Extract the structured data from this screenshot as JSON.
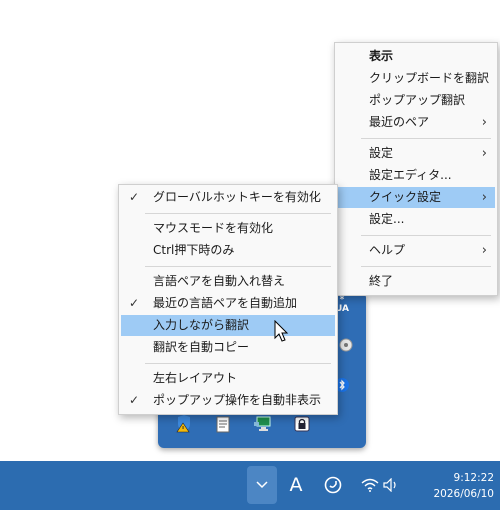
{
  "main_menu": {
    "items": [
      {
        "label": "表示",
        "bold": true,
        "submenu": false
      },
      {
        "label": "クリップボードを翻訳",
        "submenu": false
      },
      {
        "label": "ポップアップ翻訳",
        "submenu": false
      },
      {
        "label": "最近のペア",
        "submenu": true
      },
      {
        "label": "設定",
        "submenu": true
      },
      {
        "label": "設定エディタ...",
        "submenu": false
      },
      {
        "label": "クイック設定",
        "submenu": true,
        "highlighted": true
      },
      {
        "label": "設定...",
        "submenu": false
      },
      {
        "label": "ヘルプ",
        "submenu": true
      },
      {
        "label": "終了",
        "submenu": false
      }
    ]
  },
  "quick_settings_menu": {
    "items": [
      {
        "label": "グローバルホットキーを有効化",
        "checked": true
      },
      {
        "label": "マウスモードを有効化",
        "checked": false
      },
      {
        "label": "Ctrl押下時のみ",
        "checked": false
      },
      {
        "label": "言語ペアを自動入れ替え",
        "checked": false
      },
      {
        "label": "最近の言語ペアを自動追加",
        "checked": true
      },
      {
        "label": "入力しながら翻訳",
        "checked": false,
        "highlighted": true
      },
      {
        "label": "翻訳を自動コピー",
        "checked": false
      },
      {
        "label": "左右レイアウト",
        "checked": false
      },
      {
        "label": "ポップアップ操作を自動非表示",
        "checked": true
      }
    ]
  },
  "tray_flyout": {
    "ua_label": "UA",
    "icons": [
      "shield-warning-icon",
      "document-icon",
      "network-monitor-icon",
      "lock-icon",
      "bluetooth-icon",
      "disc-icon"
    ]
  },
  "taskbar": {
    "ime_label": "A",
    "time": "9:12:22",
    "date": "2026/06/10"
  },
  "colors": {
    "taskbar": "#2c6cb0",
    "highlight": "#9ecbf5",
    "menu_bg": "#f9f9f9"
  }
}
